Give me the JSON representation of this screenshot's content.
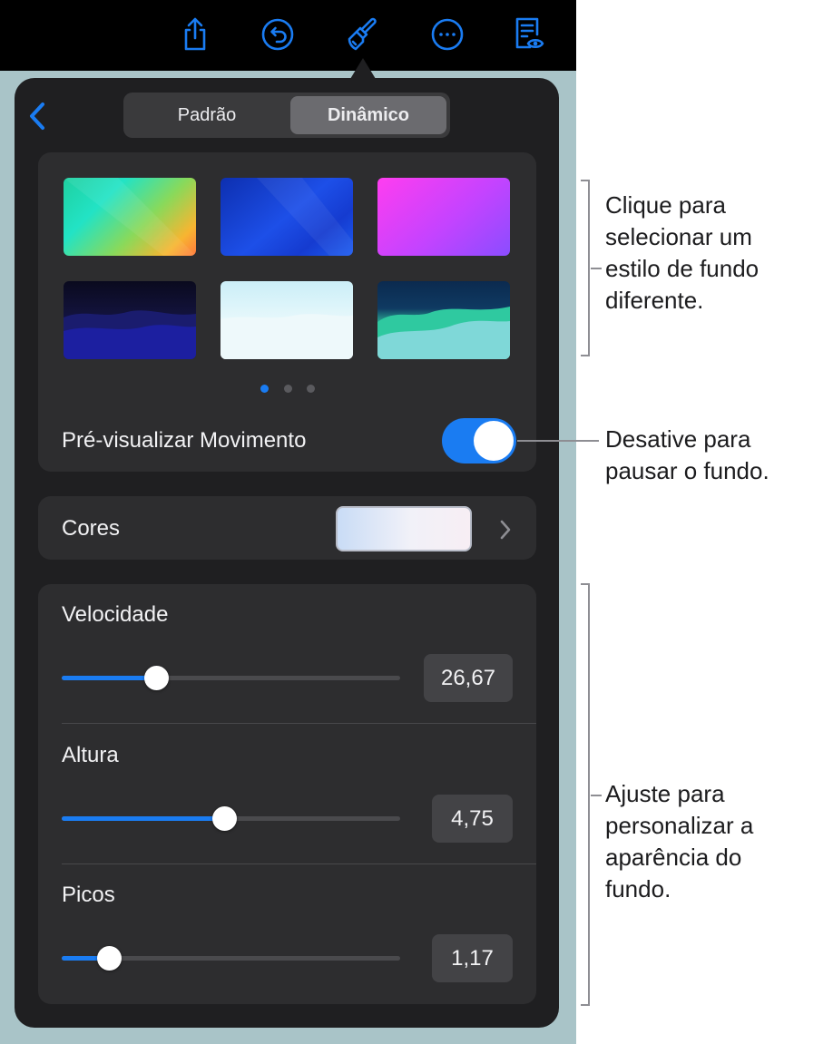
{
  "toolbar": {
    "icons": [
      "share-icon",
      "undo-icon",
      "paintbrush-icon",
      "more-icon",
      "presenter-notes-icon"
    ],
    "accent_color": "#1a7cf2"
  },
  "popover": {
    "segmented": {
      "option1": "Padrão",
      "option2": "Dinâmico",
      "selected": "Dinâmico"
    },
    "styles": {
      "page_count": 3,
      "current_page": 1,
      "preview_motion_label": "Pré-visualizar Movimento",
      "preview_motion_on": true
    },
    "colors": {
      "label": "Cores"
    },
    "sliders": [
      {
        "label": "Velocidade",
        "value": "26,67",
        "fill": 0.28
      },
      {
        "label": "Altura",
        "value": "4,75",
        "fill": 0.48
      },
      {
        "label": "Picos",
        "value": "1,17",
        "fill": 0.14
      }
    ]
  },
  "callouts": {
    "styles": [
      "Clique para",
      "selecionar um",
      "estilo de fundo",
      "diferente."
    ],
    "toggle": [
      "Desative para",
      "pausar o fundo."
    ],
    "sliders": [
      "Ajuste para",
      "personalizar a",
      "aparência do",
      "fundo."
    ]
  }
}
